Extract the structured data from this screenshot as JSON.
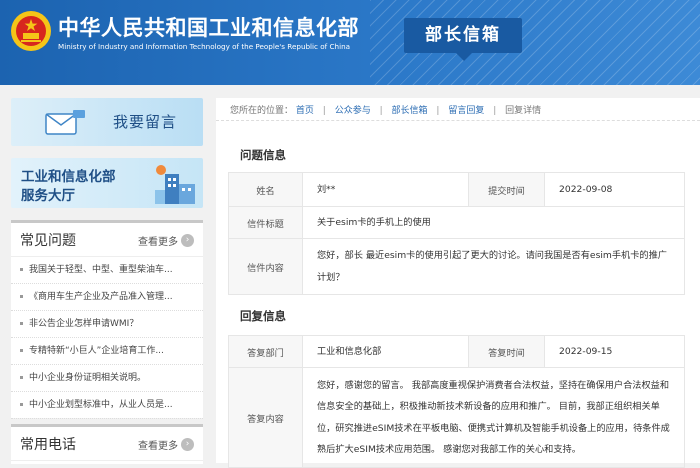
{
  "header": {
    "title": "中华人民共和国工业和信息化部",
    "subtitle": "Ministry of Industry and Information Technology of the People's Republic of China",
    "badge": "部长信箱"
  },
  "sidebar": {
    "banner_message_label": "我要留言",
    "banner_service_line1": "工业和信息化部",
    "banner_service_line2": "服务大厅",
    "faq": {
      "title": "常见问题",
      "more": "查看更多",
      "items": [
        "我国关于轻型、中型、重型柴油车...",
        "《商用车生产企业及产品准入管理...",
        "非公告企业怎样申请WMI？",
        "专精特新“小巨人”企业培育工作...",
        "中小企业身份证明相关说明。",
        "中小企业划型标准中，从业人员是..."
      ]
    },
    "phone": {
      "title": "常用电话",
      "more": "查看更多"
    }
  },
  "breadcrumb": {
    "prefix": "您所在的位置：",
    "items": [
      "首页",
      "公众参与",
      "部长信箱",
      "留言回复"
    ],
    "current": "回复详情"
  },
  "question": {
    "section_title": "问题信息",
    "name_label": "姓名",
    "name_value": "刘**",
    "time_label": "提交时间",
    "time_value": "2022-09-08",
    "subject_label": "信件标题",
    "subject_value": "关于esim卡的手机上的使用",
    "content_label": "信件内容",
    "content_value": "您好，部长 最近esim卡的使用引起了更大的讨论。请问我国是否有esim手机卡的推广计划？"
  },
  "reply": {
    "section_title": "回复信息",
    "dept_label": "答复部门",
    "dept_value": "工业和信息化部",
    "time_label": "答复时间",
    "time_value": "2022-09-15",
    "content_label": "答复内容",
    "content_value": "您好，感谢您的留言。 我部高度重视保护消费者合法权益，坚持在确保用户合法权益和信息安全的基础上，积极推动新技术新设备的应用和推广。 目前，我部正组织相关单位，研究推进eSIM技术在平板电脑、便携式计算机及智能手机设备上的应用，待条件成熟后扩大eSIM技术应用范围。 感谢您对我部工作的关心和支持。"
  },
  "colors": {
    "header_blue": "#2b78c8",
    "badge_blue": "#195aa2",
    "link_blue": "#2b6cb3",
    "emblem_red": "#d7261e",
    "emblem_gold": "#f5c518"
  }
}
